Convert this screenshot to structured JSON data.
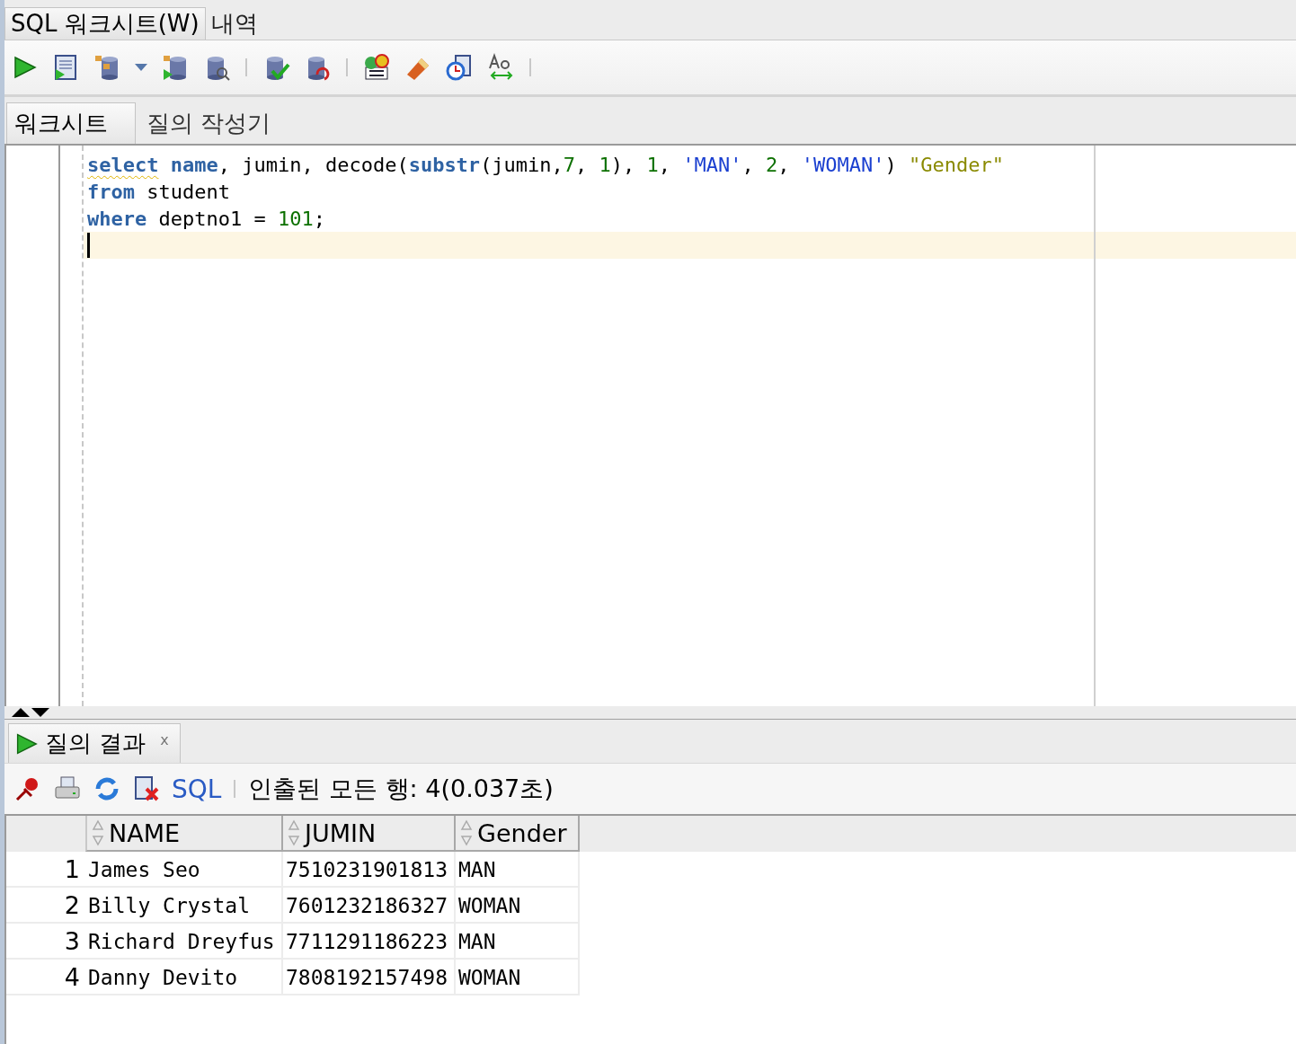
{
  "top_tabs": [
    {
      "label": "SQL 워크시트(W)",
      "selected": true
    },
    {
      "label": "내역",
      "selected": false
    }
  ],
  "editor_tabs": [
    {
      "label": "워크시트",
      "selected": true
    },
    {
      "label": "질의 작성기",
      "selected": false
    }
  ],
  "code": {
    "lines": [
      {
        "current": false,
        "tokens": [
          {
            "kind": "keyword",
            "text": "select",
            "warning": true
          },
          {
            "kind": "keyword",
            "text": " name"
          },
          {
            "kind": "plain",
            "text": ", jumin, decode("
          },
          {
            "kind": "keyword",
            "text": "substr"
          },
          {
            "kind": "plain",
            "text": "(jumin,"
          },
          {
            "kind": "number",
            "text": "7"
          },
          {
            "kind": "plain",
            "text": ", "
          },
          {
            "kind": "number",
            "text": "1"
          },
          {
            "kind": "plain",
            "text": "), "
          },
          {
            "kind": "number",
            "text": "1"
          },
          {
            "kind": "plain",
            "text": ", "
          },
          {
            "kind": "string",
            "text": "'MAN'"
          },
          {
            "kind": "plain",
            "text": ", "
          },
          {
            "kind": "number",
            "text": "2"
          },
          {
            "kind": "plain",
            "text": ", "
          },
          {
            "kind": "string",
            "text": "'WOMAN'"
          },
          {
            "kind": "plain",
            "text": ") "
          },
          {
            "kind": "alias",
            "text": "\"Gender\""
          }
        ]
      },
      {
        "current": false,
        "tokens": [
          {
            "kind": "keyword",
            "text": "from"
          },
          {
            "kind": "plain",
            "text": " student"
          }
        ]
      },
      {
        "current": false,
        "tokens": [
          {
            "kind": "keyword",
            "text": "where"
          },
          {
            "kind": "plain",
            "text": " deptno1 = "
          },
          {
            "kind": "number",
            "text": "101"
          },
          {
            "kind": "plain",
            "text": ";"
          }
        ]
      },
      {
        "current": true
      }
    ]
  },
  "result_tab": {
    "label": "질의 결과",
    "close": "x",
    "selected": true
  },
  "result_toolbar": {
    "sql_link": "SQL",
    "status": "인출된 모든 행: 4(0.037초)"
  },
  "table": {
    "columns": [
      "NAME",
      "JUMIN",
      "Gender"
    ],
    "rows": [
      {
        "number": "1",
        "cells": [
          "James Seo",
          "7510231901813",
          "MAN"
        ]
      },
      {
        "number": "2",
        "cells": [
          "Billy Crystal",
          "7601232186327",
          "WOMAN"
        ]
      },
      {
        "number": "3",
        "cells": [
          "Richard Dreyfus",
          "7711291186223",
          "MAN"
        ]
      },
      {
        "number": "4",
        "cells": [
          "Danny Devito",
          "7808192157498",
          "WOMAN"
        ]
      }
    ]
  }
}
